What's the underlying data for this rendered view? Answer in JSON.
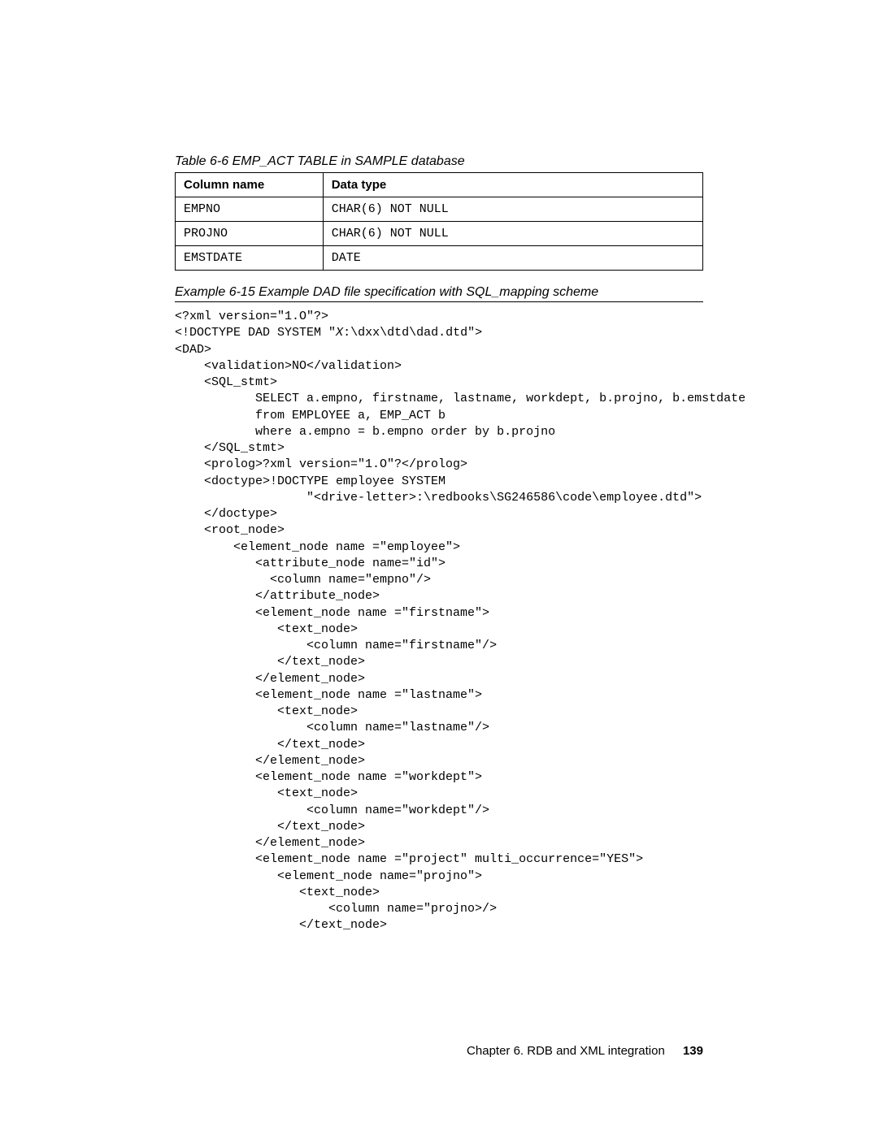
{
  "tableCaption": "Table 6-6   EMP_ACT TABLE in SAMPLE database",
  "table": {
    "headers": {
      "col1": "Column name",
      "col2": "Data type"
    },
    "rows": [
      {
        "col1": "EMPNO",
        "col2": "CHAR(6) NOT NULL"
      },
      {
        "col1": "PROJNO",
        "col2": "CHAR(6) NOT NULL"
      },
      {
        "col1": "EMSTDATE",
        "col2": "DATE"
      }
    ]
  },
  "exampleCaption": "Example 6-15   Example DAD file specification with SQL_mapping scheme",
  "code": {
    "l1": "<?xml version=\"1.O\"?>",
    "l2a": "<!DOCTYPE DAD SYSTEM \"",
    "l2b": "X",
    "l2c": ":\\dxx\\dtd\\dad.dtd\">",
    "l3": "<DAD>",
    "l4": "    <validation>NO</validation>",
    "l5": "    <SQL_stmt>",
    "l6": "           SELECT a.empno, firstname, lastname, workdept, b.projno, b.emstdate",
    "l7": "           from EMPLOYEE a, EMP_ACT b",
    "l8": "           where a.empno = b.empno order by b.projno",
    "l9": "    </SQL_stmt>",
    "l10": "    <prolog>?xml version=\"1.O\"?</prolog>",
    "l11": "    <doctype>!DOCTYPE employee SYSTEM",
    "l12": "                  \"<drive-letter>:\\redbooks\\SG246586\\code\\employee.dtd\">",
    "l13": "    </doctype>",
    "l14": "    <root_node>",
    "l15": "        <element_node name =\"employee\">",
    "l16": "           <attribute_node name=\"id\">",
    "l17": "             <column name=\"empno\"/>",
    "l18": "           </attribute_node>",
    "l19": "           <element_node name =\"firstname\">",
    "l20": "              <text_node>",
    "l21": "                  <column name=\"firstname\"/>",
    "l22": "              </text_node>",
    "l23": "           </element_node>",
    "l24": "           <element_node name =\"lastname\">",
    "l25": "              <text_node>",
    "l26": "                  <column name=\"lastname\"/>",
    "l27": "              </text_node>",
    "l28": "           </element_node>",
    "l29": "           <element_node name =\"workdept\">",
    "l30": "              <text_node>",
    "l31": "                  <column name=\"workdept\"/>",
    "l32": "              </text_node>",
    "l33": "           </element_node>",
    "l34": "           <element_node name =\"project\" multi_occurrence=\"YES\">",
    "l35": "              <element_node name=\"projno\">",
    "l36": "                 <text_node>",
    "l37": "                     <column name=\"projno>/>",
    "l38": "                 </text_node>"
  },
  "footer": {
    "chapter": "Chapter 6. RDB and XML integration",
    "page": "139"
  }
}
